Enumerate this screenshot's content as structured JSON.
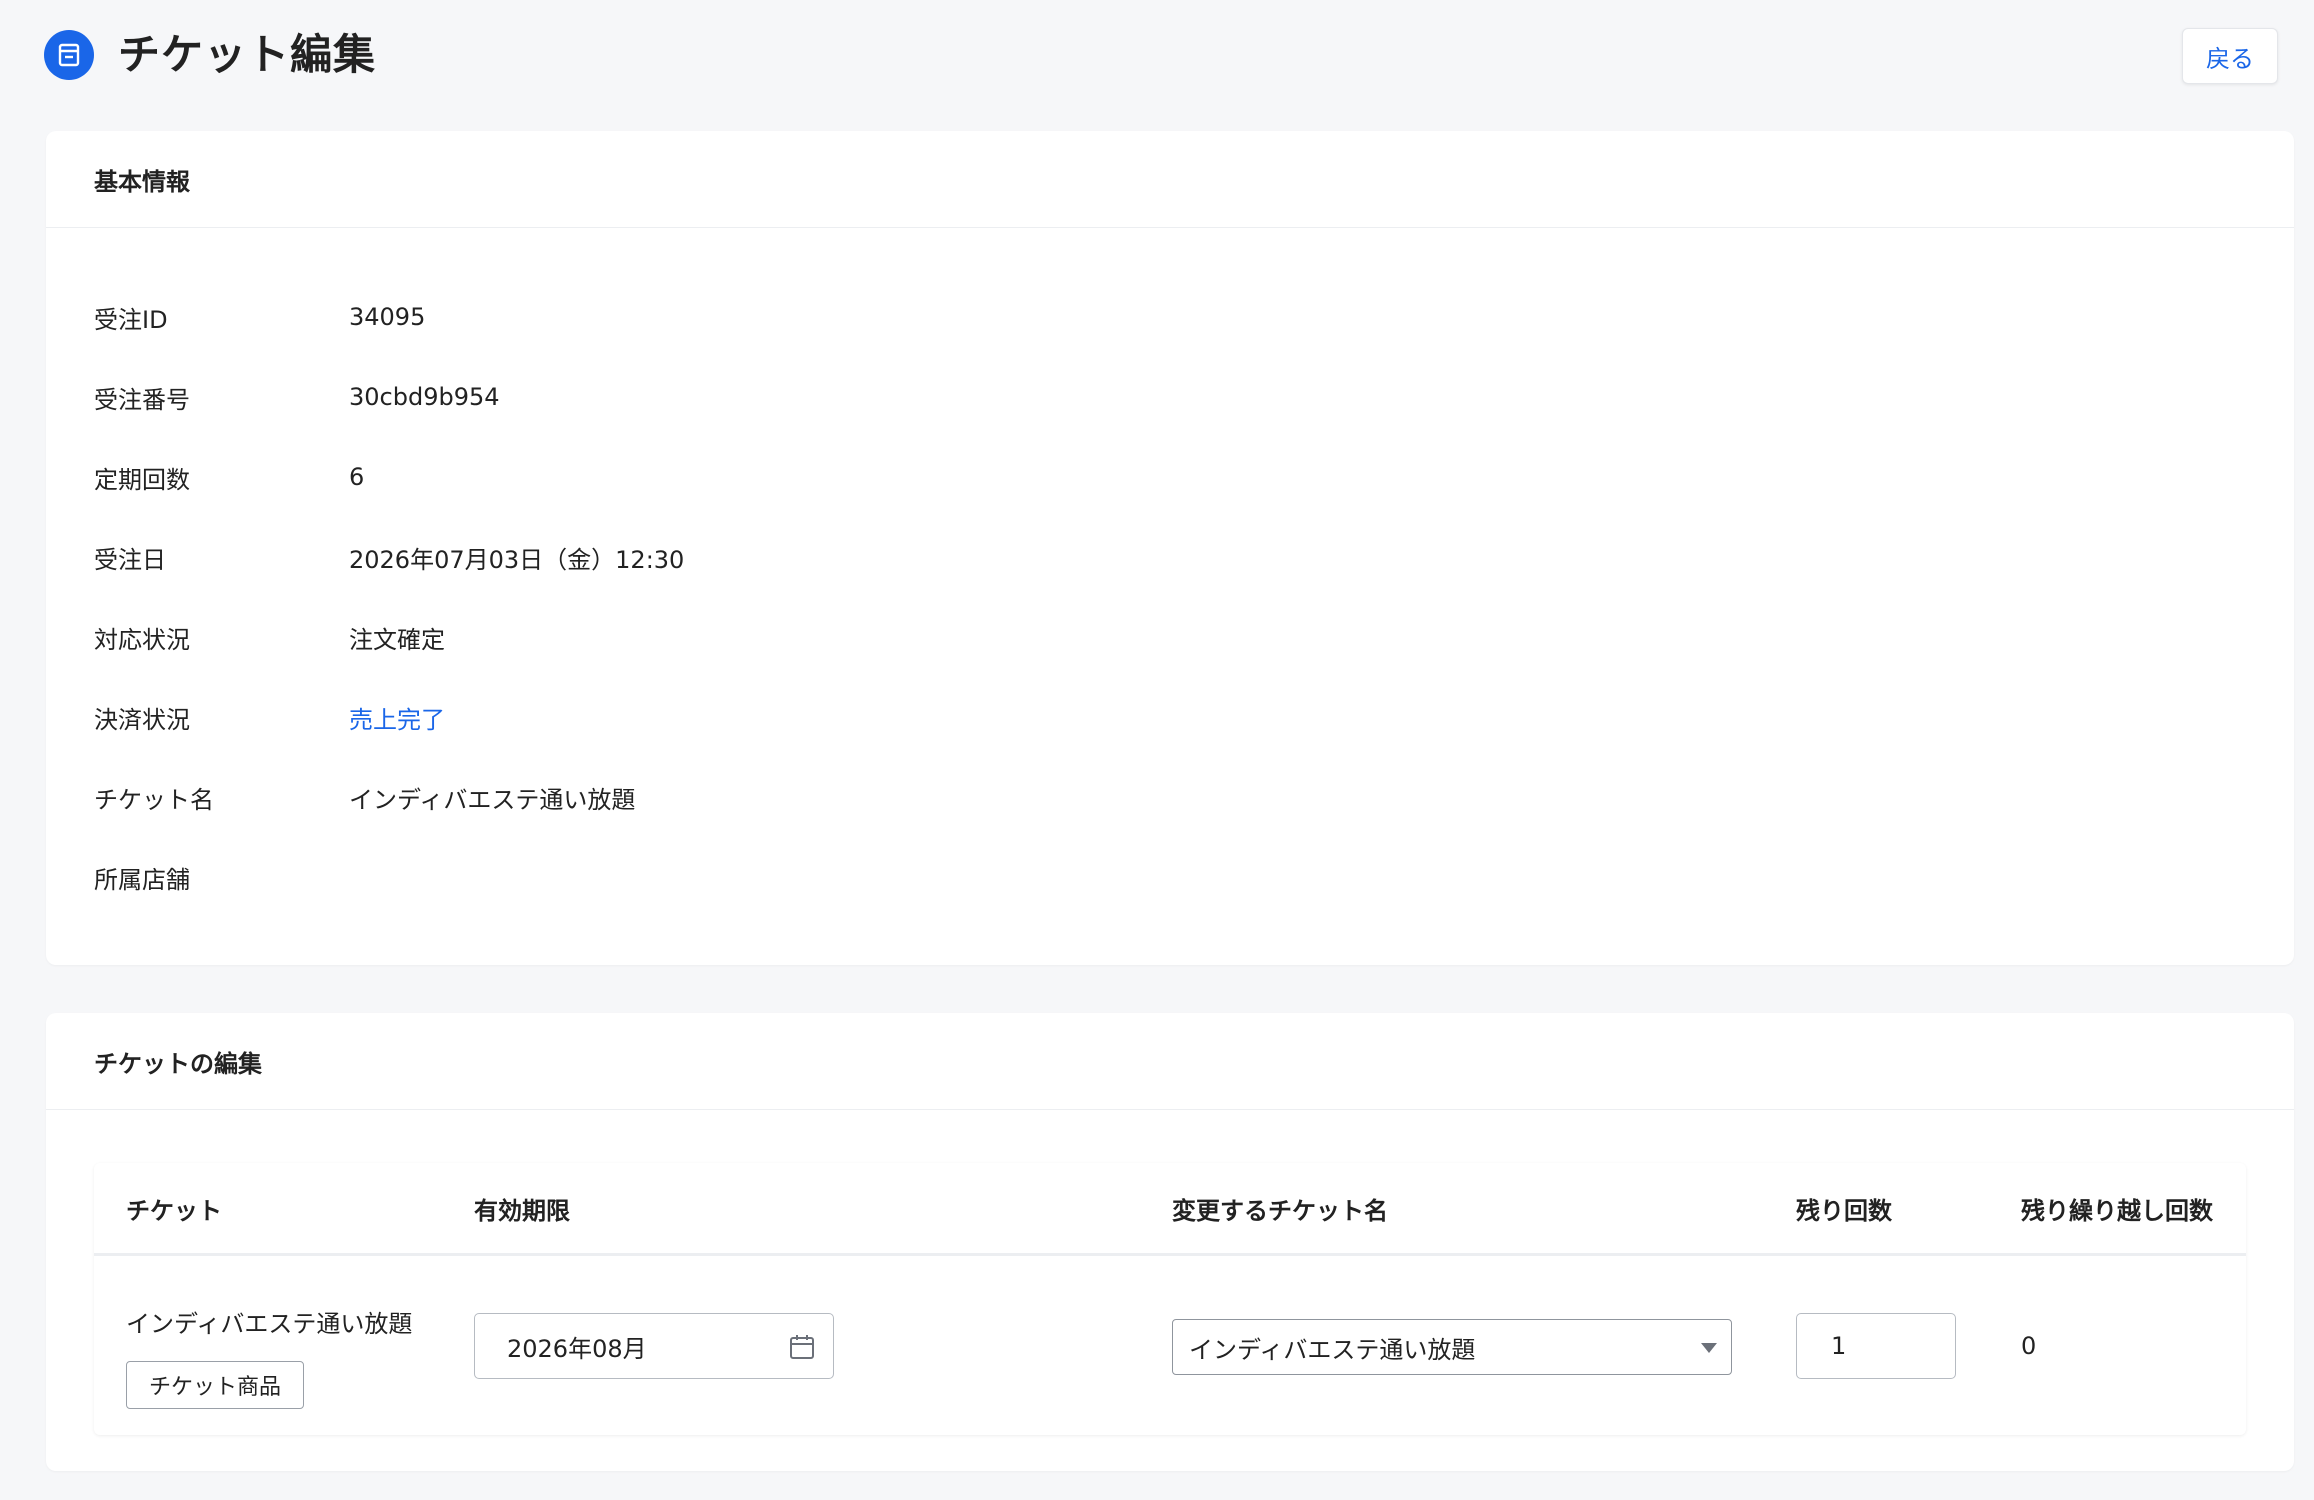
{
  "header": {
    "title": "チケット編集",
    "back_label": "戻る",
    "icon": "ticket-icon"
  },
  "basic_info": {
    "heading": "基本情報",
    "rows": [
      {
        "label": "受注ID",
        "value": "34095"
      },
      {
        "label": "受注番号",
        "value": "30cbd9b954"
      },
      {
        "label": "定期回数",
        "value": "6"
      },
      {
        "label": "受注日",
        "value": "2026年07月03日（金）12:30"
      },
      {
        "label": "対応状況",
        "value": "注文確定"
      },
      {
        "label": "決済状況",
        "value": "売上完了"
      },
      {
        "label": "チケット名",
        "value": "インディバエステ通い放題"
      },
      {
        "label": "所属店舗",
        "value": ""
      }
    ]
  },
  "ticket_edit": {
    "heading": "チケットの編集",
    "columns": [
      "チケット",
      "有効期限",
      "変更するチケット名",
      "残り回数",
      "残り繰り越し回数"
    ],
    "row": {
      "ticket_name": "インディバエステ通い放題",
      "product_tag": "チケット商品",
      "expiry_value": "2026年08月",
      "selected_ticket": "インディバエステ通い放題",
      "remaining_count": "1",
      "carryover_count": "0"
    }
  },
  "colors": {
    "accent": "#1a66e8",
    "background": "#f6f7f9"
  }
}
